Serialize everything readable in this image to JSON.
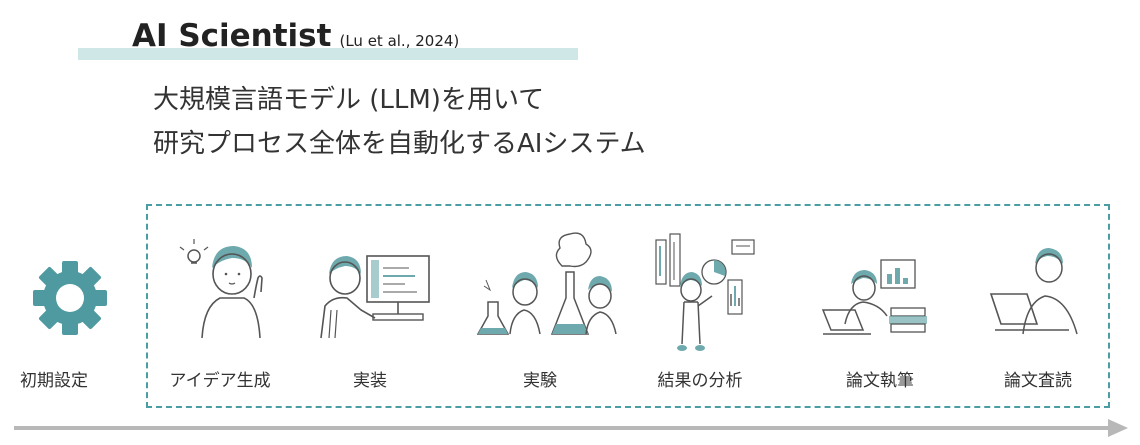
{
  "title": {
    "main": "AI Scientist",
    "citation": "(Lu et al., 2024)"
  },
  "subtitle": {
    "line1": "大規模言語モデル (LLM)を用いて",
    "line2": "研究プロセス全体を自動化するAIシステム"
  },
  "initial": {
    "label": "初期設定",
    "icon": "gear-icon"
  },
  "steps": [
    {
      "label": "アイデア生成",
      "icon": "idea-person-icon"
    },
    {
      "label": "実装",
      "icon": "coding-person-icon"
    },
    {
      "label": "実験",
      "icon": "lab-experiment-icon"
    },
    {
      "label": "結果の分析",
      "icon": "data-analysis-icon"
    },
    {
      "label": "論文執筆",
      "icon": "paper-writing-icon"
    },
    {
      "label": "論文査読",
      "icon": "paper-review-icon"
    }
  ],
  "colors": {
    "accent_teal": "#4a9ea3",
    "gear": "#4f9aa0",
    "hair": "#6ea9ad",
    "underline": "#cfe7e6",
    "arrow": "#b8b8b8"
  }
}
